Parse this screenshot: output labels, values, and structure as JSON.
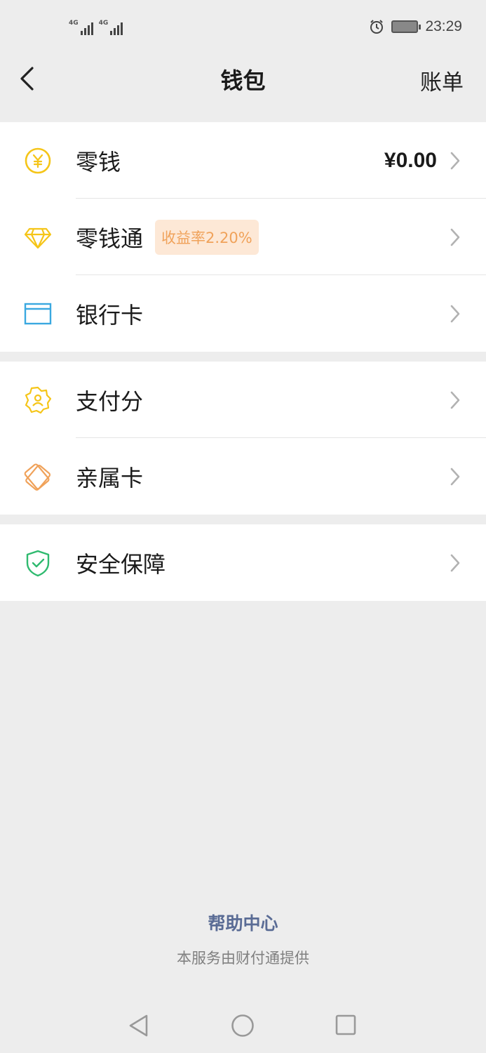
{
  "status": {
    "network_1": "4G",
    "network_2": "4G",
    "time": "23:29",
    "alarm_icon": "alarm-icon",
    "battery_icon": "battery-icon"
  },
  "header": {
    "title": "钱包",
    "bill_label": "账单",
    "back_icon": "back-chevron-icon"
  },
  "groups": [
    {
      "items": [
        {
          "label": "零钱",
          "icon": "yuan-coin-icon",
          "value": "¥0.00",
          "color": "#f5c518"
        },
        {
          "label": "零钱通",
          "icon": "diamond-icon",
          "badge": "收益率2.20%",
          "color": "#f5c518"
        },
        {
          "label": "银行卡",
          "icon": "bank-card-icon",
          "color": "#3aa8e0"
        }
      ]
    },
    {
      "items": [
        {
          "label": "支付分",
          "icon": "pay-score-icon",
          "color": "#f5c518"
        },
        {
          "label": "亲属卡",
          "icon": "family-card-icon",
          "color": "#f0a25a"
        }
      ]
    },
    {
      "items": [
        {
          "label": "安全保障",
          "icon": "shield-check-icon",
          "color": "#2fba6f"
        }
      ]
    }
  ],
  "footer": {
    "help_center": "帮助中心",
    "provider_note": "本服务由财付通提供"
  },
  "system_nav": {
    "back_icon": "nav-back-triangle-icon",
    "home_icon": "nav-home-circle-icon",
    "recents_icon": "nav-recents-square-icon"
  }
}
